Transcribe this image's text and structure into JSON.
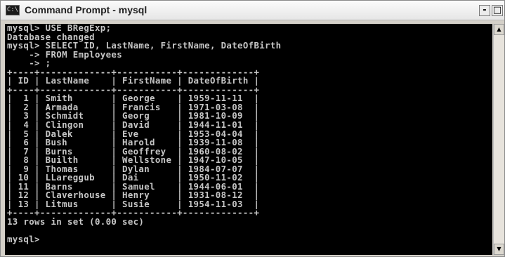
{
  "window": {
    "title": "Command Prompt - mysql",
    "icon_label": "C:\\",
    "buttons": {
      "minimize": "-",
      "maximize": "□",
      "close": "x"
    }
  },
  "console": {
    "lines": [
      "mysql> USE BRegExp;",
      "Database changed",
      "mysql> SELECT ID, LastName, FirstName, DateOfBirth",
      "    -> FROM Employees",
      "    -> ;",
      "+----+-------------+-----------+-------------+",
      "| ID | LastName    | FirstName | DateOfBirth |",
      "+----+-------------+-----------+-------------+",
      "|  1 | Smith       | George    | 1959-11-11  |",
      "|  2 | Armada      | Francis   | 1971-03-08  |",
      "|  3 | Schmidt     | Georg     | 1981-10-09  |",
      "|  4 | Clingon     | David     | 1944-11-01  |",
      "|  5 | Dalek       | Eve       | 1953-04-04  |",
      "|  6 | Bush        | Harold    | 1939-11-08  |",
      "|  7 | Burns       | Geoffrey  | 1960-08-02  |",
      "|  8 | Builth      | Wellstone | 1947-10-05  |",
      "|  9 | Thomas      | Dylan     | 1984-07-07  |",
      "| 10 | LLareggub   | Dai       | 1950-11-02  |",
      "| 11 | Barns       | Samuel    | 1944-06-01  |",
      "| 12 | Claverhouse | Henry     | 1931-08-12  |",
      "| 13 | Litmus      | Susie     | 1954-11-03  |",
      "+----+-------------+-----------+-------------+",
      "13 rows in set (0.00 sec)",
      "",
      "mysql> "
    ]
  },
  "scrollbar": {
    "up_arrow": "▲",
    "down_arrow": "▼"
  }
}
